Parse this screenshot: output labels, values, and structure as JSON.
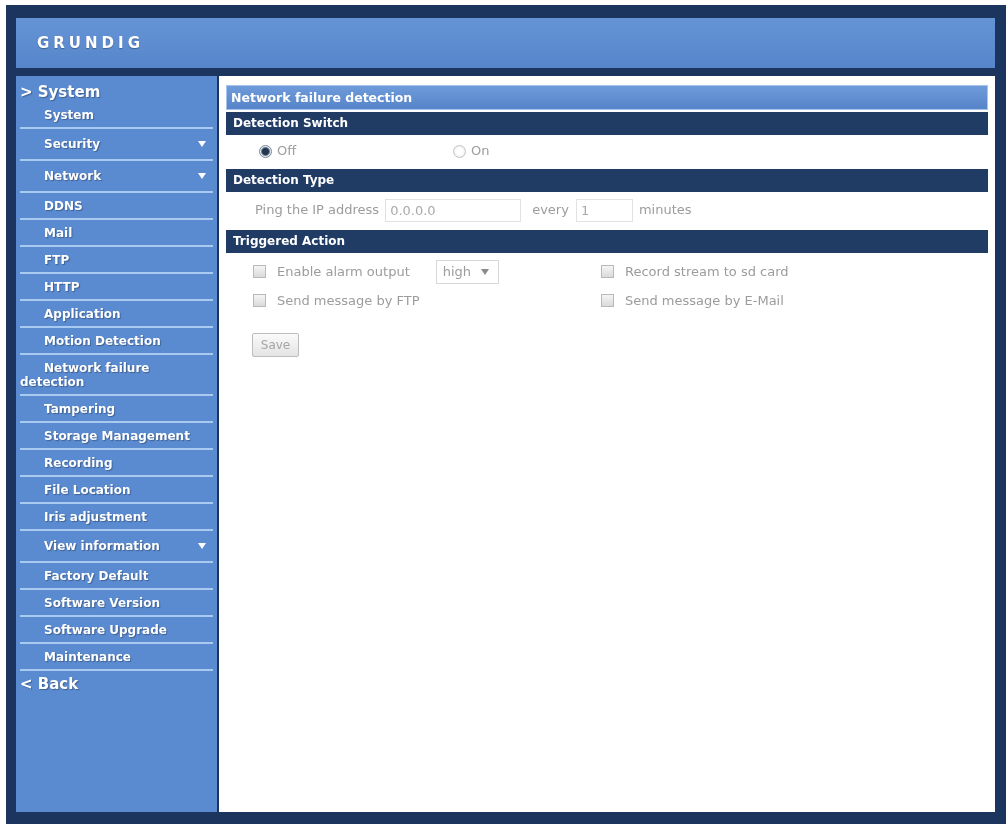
{
  "header": {
    "logo": "GRUNDIG"
  },
  "sidebar": {
    "heading": "> System",
    "items": [
      {
        "label": "System",
        "submenu": false
      },
      {
        "label": "Security",
        "submenu": true
      },
      {
        "label": "Network",
        "submenu": true
      },
      {
        "label": "DDNS",
        "submenu": false
      },
      {
        "label": "Mail",
        "submenu": false
      },
      {
        "label": "FTP",
        "submenu": false
      },
      {
        "label": "HTTP",
        "submenu": false
      },
      {
        "label": "Application",
        "submenu": false
      },
      {
        "label": "Motion Detection",
        "submenu": false
      },
      {
        "label": "Network failure detection",
        "submenu": false
      },
      {
        "label": "Tampering",
        "submenu": false
      },
      {
        "label": "Storage Management",
        "submenu": false
      },
      {
        "label": "Recording",
        "submenu": false
      },
      {
        "label": "File Location",
        "submenu": false
      },
      {
        "label": "Iris adjustment",
        "submenu": false
      },
      {
        "label": "View information",
        "submenu": true
      },
      {
        "label": "Factory Default",
        "submenu": false
      },
      {
        "label": "Software Version",
        "submenu": false
      },
      {
        "label": "Software Upgrade",
        "submenu": false
      },
      {
        "label": "Maintenance",
        "submenu": false
      }
    ],
    "back": "< Back"
  },
  "content": {
    "title": "Network failure detection",
    "sections": [
      {
        "kind": "radio",
        "title": "Detection Switch",
        "options": [
          {
            "label": "Off",
            "selected": true
          },
          {
            "label": "On",
            "selected": false
          }
        ]
      },
      {
        "kind": "ping",
        "title": "Detection Type",
        "label": "Ping the IP address",
        "address": "0.0.0.0",
        "every": "every",
        "interval": "1",
        "unit": "minutes"
      },
      {
        "kind": "actions",
        "title": "Triggered Action",
        "actions": [
          {
            "label": "Enable alarm output",
            "checked": false,
            "option": "high"
          },
          {
            "label": "Record stream to sd card",
            "checked": false
          },
          {
            "label": "Send message by FTP",
            "checked": false
          },
          {
            "label": "Send message by E-Mail",
            "checked": false
          }
        ]
      }
    ],
    "save": "Save"
  }
}
